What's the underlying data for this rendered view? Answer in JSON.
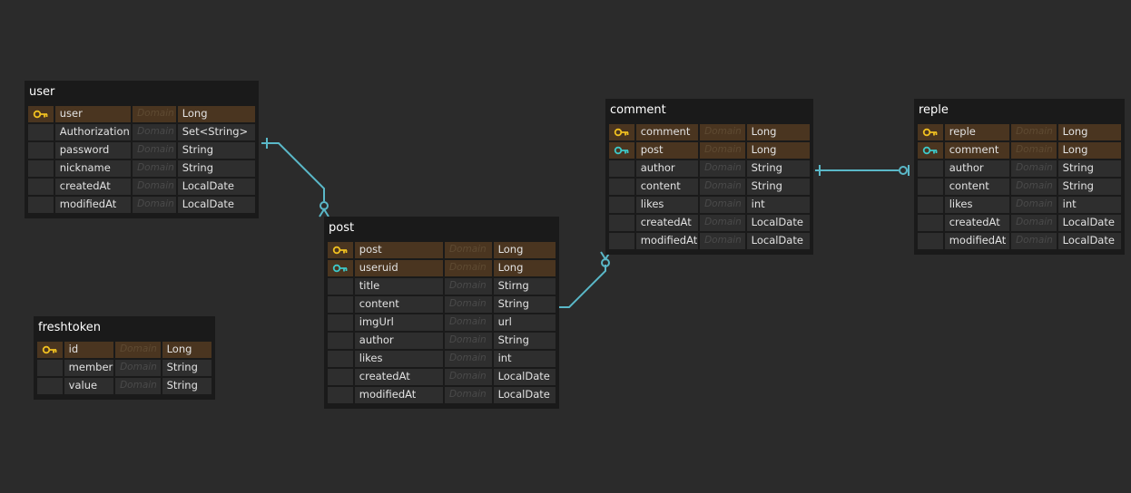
{
  "colors": {
    "background": "#2b2b2b",
    "entity_bg": "#1a1a1a",
    "row_bg": "#2e2e2e",
    "key_row_bg": "#4a3520",
    "primary_key": "#f0c020",
    "foreign_key": "#3ec8c8",
    "connector": "#5ab8c8"
  },
  "domain_placeholder": "Domain",
  "tables": [
    {
      "name": "user",
      "columns": [
        {
          "name": "user",
          "type": "Long",
          "key": "primary"
        },
        {
          "name": "Authorization",
          "type": "Set<String>",
          "key": ""
        },
        {
          "name": "password",
          "type": "String",
          "key": ""
        },
        {
          "name": "nickname",
          "type": "String",
          "key": ""
        },
        {
          "name": "createdAt",
          "type": "LocalDate",
          "key": ""
        },
        {
          "name": "modifiedAt",
          "type": "LocalDate",
          "key": ""
        }
      ]
    },
    {
      "name": "post",
      "columns": [
        {
          "name": "post",
          "type": "Long",
          "key": "primary"
        },
        {
          "name": "useruid",
          "type": "Long",
          "key": "foreign"
        },
        {
          "name": "title",
          "type": "Stirng",
          "key": ""
        },
        {
          "name": "content",
          "type": "String",
          "key": ""
        },
        {
          "name": "imgUrl",
          "type": "url",
          "key": ""
        },
        {
          "name": "author",
          "type": "String",
          "key": ""
        },
        {
          "name": "likes",
          "type": "int",
          "key": ""
        },
        {
          "name": "createdAt",
          "type": "LocalDate",
          "key": ""
        },
        {
          "name": "modifiedAt",
          "type": "LocalDate",
          "key": ""
        }
      ]
    },
    {
      "name": "comment",
      "columns": [
        {
          "name": "comment",
          "type": "Long",
          "key": "primary"
        },
        {
          "name": "post",
          "type": "Long",
          "key": "foreign"
        },
        {
          "name": "author",
          "type": "String",
          "key": ""
        },
        {
          "name": "content",
          "type": "String",
          "key": ""
        },
        {
          "name": "likes",
          "type": "int",
          "key": ""
        },
        {
          "name": "createdAt",
          "type": "LocalDate",
          "key": ""
        },
        {
          "name": "modifiedAt",
          "type": "LocalDate",
          "key": ""
        }
      ]
    },
    {
      "name": "reple",
      "columns": [
        {
          "name": "reple",
          "type": "Long",
          "key": "primary"
        },
        {
          "name": "comment",
          "type": "Long",
          "key": "foreign"
        },
        {
          "name": "author",
          "type": "String",
          "key": ""
        },
        {
          "name": "content",
          "type": "String",
          "key": ""
        },
        {
          "name": "likes",
          "type": "int",
          "key": ""
        },
        {
          "name": "createdAt",
          "type": "LocalDate",
          "key": ""
        },
        {
          "name": "modifiedAt",
          "type": "LocalDate",
          "key": ""
        }
      ]
    },
    {
      "name": "freshtoken",
      "columns": [
        {
          "name": "id",
          "type": "Long",
          "key": "primary"
        },
        {
          "name": "member",
          "type": "String",
          "key": ""
        },
        {
          "name": "value",
          "type": "String",
          "key": ""
        }
      ]
    }
  ],
  "relationships": [
    {
      "from": "user",
      "to": "post",
      "from_cardinality": "one",
      "to_cardinality": "zero-or-many"
    },
    {
      "from": "post",
      "to": "comment",
      "from_cardinality": "one",
      "to_cardinality": "zero-or-many"
    },
    {
      "from": "comment",
      "to": "reple",
      "from_cardinality": "one",
      "to_cardinality": "zero-or-one"
    }
  ]
}
